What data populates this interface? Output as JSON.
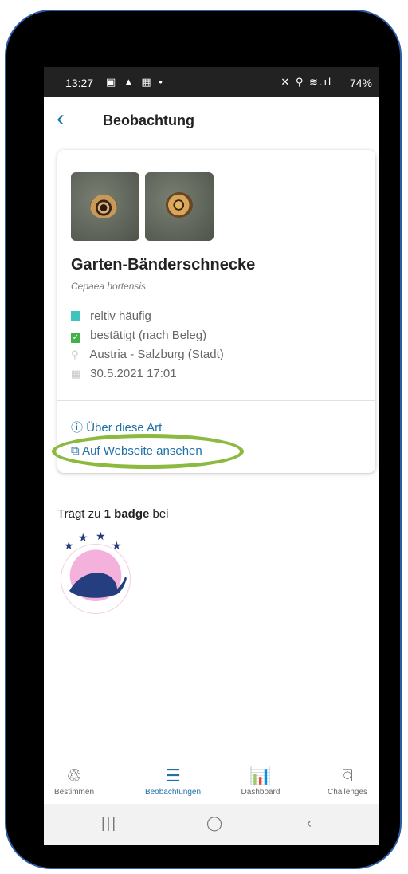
{
  "status_bar": {
    "time": "13:27",
    "left_icons": "▣ ▲ ▦ •",
    "right_icons": "✕ ⚲ ≋.ıl",
    "battery": "74%"
  },
  "app_bar": {
    "back_icon": "chevron-left",
    "title": "Beobachtung"
  },
  "observation": {
    "common_name": "Garten-Bänderschnecke",
    "latin_name": "Cepaea hortensis",
    "frequency": "reltiv häufig",
    "status": "bestätigt (nach Beleg)",
    "location": "Austria - Salzburg (Stadt)",
    "datetime": "30.5.2021 17:01",
    "images": [
      "snail-photo-1",
      "snail-photo-2"
    ]
  },
  "links": {
    "about_species": "Über diese Art",
    "view_website": "Auf Webseite ansehen"
  },
  "badges": {
    "prefix": "Trägt zu ",
    "count_label": "1 badge",
    "suffix": " bei"
  },
  "bottom_nav": [
    {
      "label": "Bestimmen",
      "icon": "identify-icon"
    },
    {
      "label": "Beobachtungen",
      "icon": "list-icon"
    },
    {
      "label": "Dashboard",
      "icon": "chart-icon"
    },
    {
      "label": "Challenges",
      "icon": "challenge-icon"
    }
  ],
  "colors": {
    "accent": "#1f6fa8",
    "highlight_oval": "#8cb93f",
    "frequency_square": "#3fc3bf",
    "status_check": "#43b04a"
  }
}
